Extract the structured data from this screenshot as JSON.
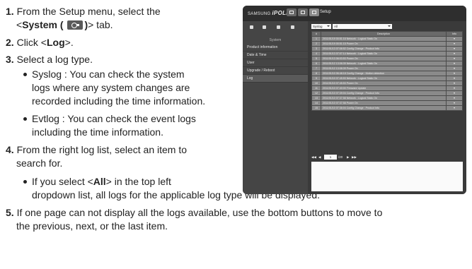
{
  "steps": [
    {
      "n": "1.",
      "a": "From the Setup menu, select the"
    },
    {
      "n": "2.",
      "a": "Click <",
      "bold": "Log",
      "b": ">."
    },
    {
      "n": "3.",
      "a": "Select a log type."
    },
    {
      "n": "4.",
      "a": "From the right log list, select an item to"
    },
    {
      "n": "5.",
      "a": "If one page can not display all the logs available, use the bottom buttons to move to"
    }
  ],
  "step1_line2": {
    "pre": "<",
    "bold": "System (",
    "bold2": ")",
    "post": "> tab."
  },
  "bullets": {
    "syslog": [
      "Syslog : You can check the system",
      "logs where any system changes are",
      "recorded including the time information."
    ],
    "evtlog": [
      "Evtlog : You can check the event logs",
      "including the time information."
    ],
    "all": {
      "pre": "If you select <",
      "bold": "All",
      "post": "> in the top left"
    },
    "all_line2": "dropdown list, all logs for the applicable log type will be displayed."
  },
  "step4_line2": "search for.",
  "step5_line2": "the previous, next, or the last item.",
  "screenshot": {
    "logo_brand": "SAMSUNG",
    "logo_name": "iPOLiS",
    "setup_label": "Setup",
    "system_label": "System",
    "menu": [
      "Product information",
      "Date & Time",
      "User",
      "Upgrade / Reboot",
      "Log"
    ],
    "log_type": "Syslog",
    "filter": "All",
    "headers": [
      "#",
      "Description",
      "Info"
    ],
    "rows": [
      [
        "1",
        "2011/01/19 00:51:16 Network : Logical Static On"
      ],
      [
        "2",
        "2011/01/19 00:51:15 Power On"
      ],
      [
        "3",
        "2011/01/13 07:08:52 Config Change : Product Info"
      ],
      [
        "4",
        "2011/01/13 07:07:14 Network : Logical Static On"
      ],
      [
        "5",
        "2011/01/13 06:03:53 Power On"
      ],
      [
        "6",
        "2011/01/12 13:08:39 Network : Logical Static On"
      ],
      [
        "7",
        "2011/01/12 13:08:39 Power On"
      ],
      [
        "8",
        "2011/01/10 06:48:18 Config Change : Motion detection"
      ],
      [
        "9",
        "2011/01/10 07:45:53 Network : Logical Static On"
      ],
      [
        "10",
        "2011/01/10 07:45:53 Power On"
      ],
      [
        "11",
        "2011/01/10 07:40:00 Firmware Update"
      ],
      [
        "12",
        "2011/01/10 07:39:04 Config Change : Product Info"
      ],
      [
        "13",
        "2011/01/10 07:37:58 Network : Logical Static On"
      ],
      [
        "14",
        "2011/01/10 07:37:58 Power On"
      ],
      [
        "15",
        "2011/01/10 07:36:04 Config Change : Product Info"
      ]
    ],
    "info_mark": "▼",
    "pager_first": "◀◀",
    "pager_prev": "◀",
    "pager_page": "1",
    "pager_total": "/20",
    "pager_next": "▶",
    "pager_last": "▶▶"
  }
}
